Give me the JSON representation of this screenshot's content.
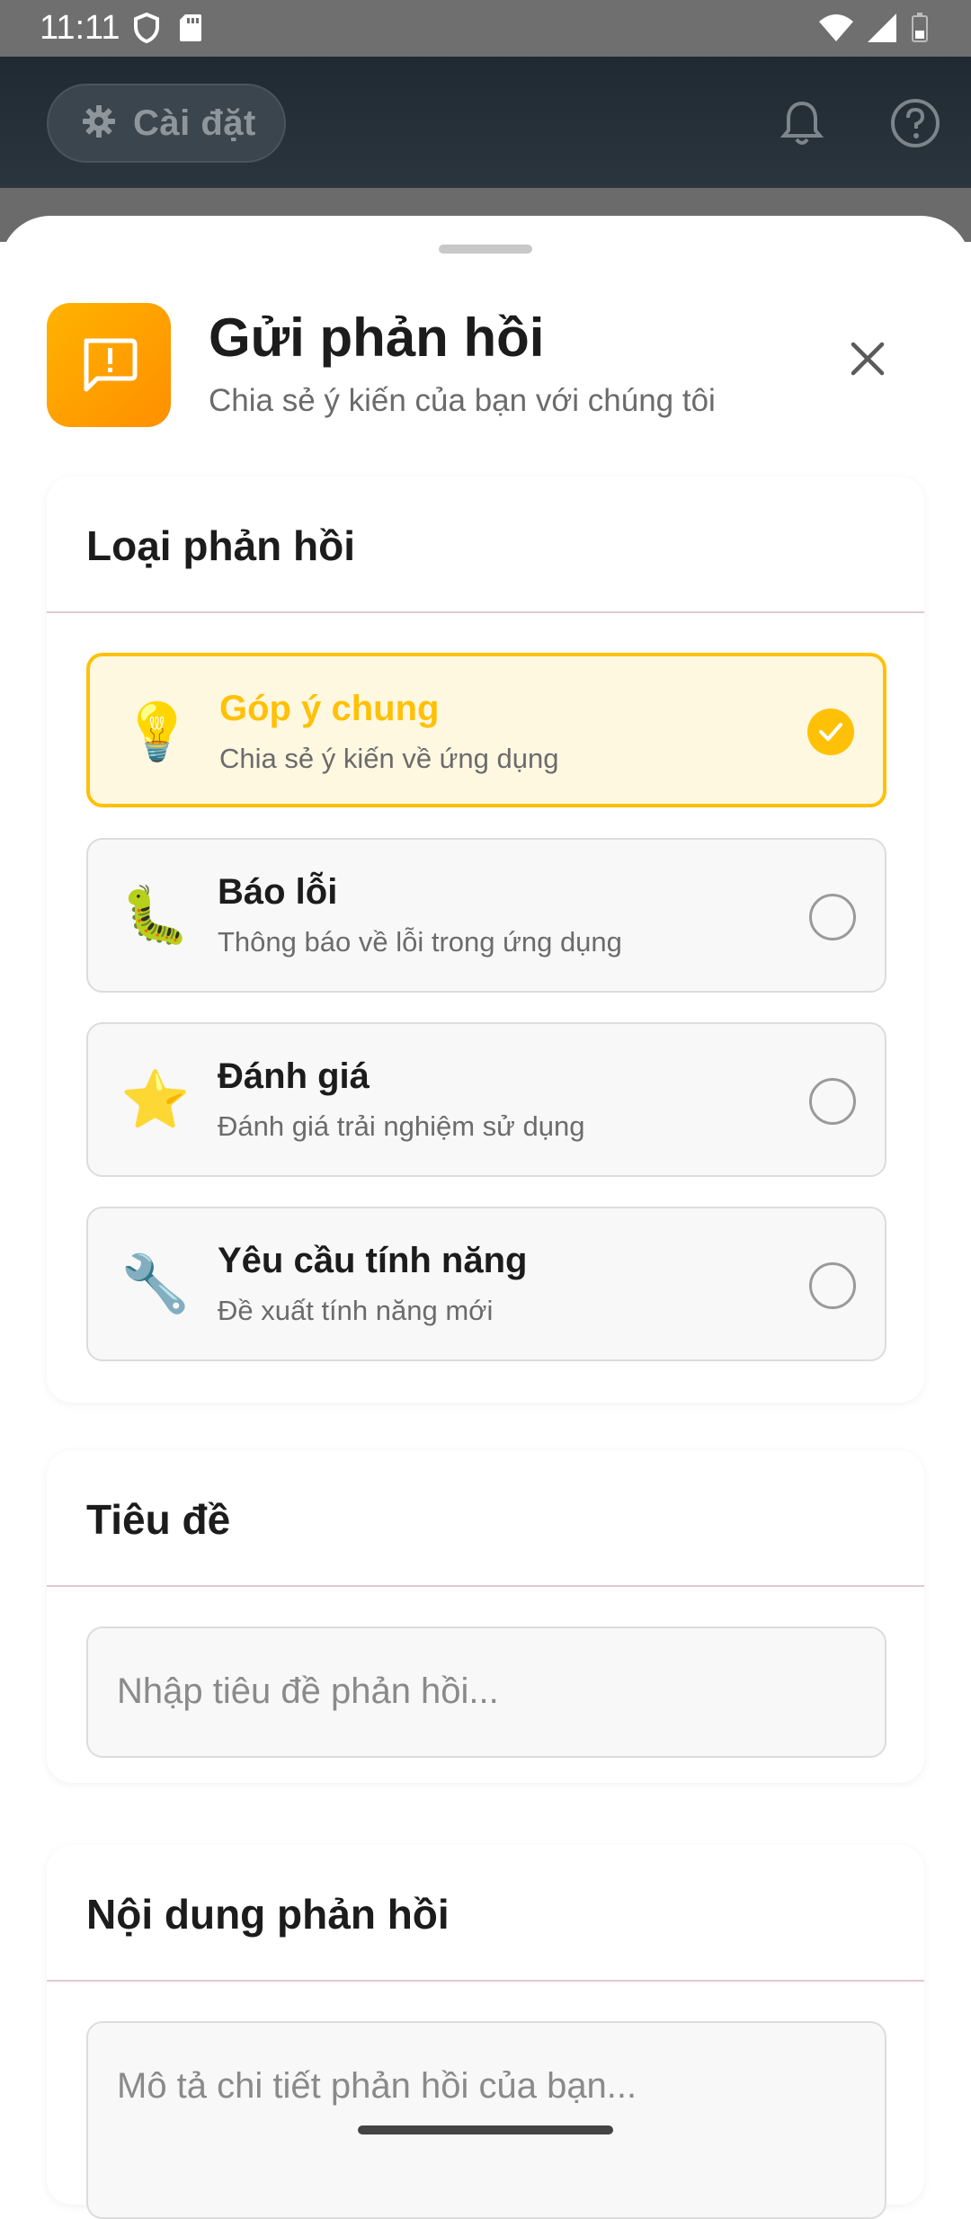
{
  "status_bar": {
    "time": "11:11",
    "left_icons": [
      "shield-icon",
      "sd-card-icon"
    ],
    "right_icons": [
      "wifi-icon",
      "signal-icon",
      "battery-icon"
    ]
  },
  "app_header": {
    "settings_label": "Cài đặt",
    "icons": [
      "gear-icon",
      "bell-icon",
      "help-icon"
    ]
  },
  "sheet": {
    "title": "Gửi phản hồi",
    "subtitle": "Chia sẻ ý kiến của bạn với chúng tôi",
    "icon": "feedback-icon",
    "close_icon": "close-icon",
    "accent_color": "#ffc107"
  },
  "feedback_type": {
    "title": "Loại phản hồi",
    "options": [
      {
        "emoji": "💡",
        "title": "Góp ý chung",
        "desc": "Chia sẻ ý kiến về ứng dụng",
        "selected": true
      },
      {
        "emoji": "🐛",
        "title": "Báo lỗi",
        "desc": "Thông báo về lỗi trong ứng dụng",
        "selected": false
      },
      {
        "emoji": "⭐",
        "title": "Đánh giá",
        "desc": "Đánh giá trải nghiệm sử dụng",
        "selected": false
      },
      {
        "emoji": "🔧",
        "title": "Yêu cầu tính năng",
        "desc": "Đề xuất tính năng mới",
        "selected": false
      }
    ]
  },
  "title_section": {
    "title": "Tiêu đề",
    "placeholder": "Nhập tiêu đề phản hồi..."
  },
  "content_section": {
    "title": "Nội dung phản hồi",
    "placeholder": "Mô tả chi tiết phản hồi của bạn..."
  }
}
